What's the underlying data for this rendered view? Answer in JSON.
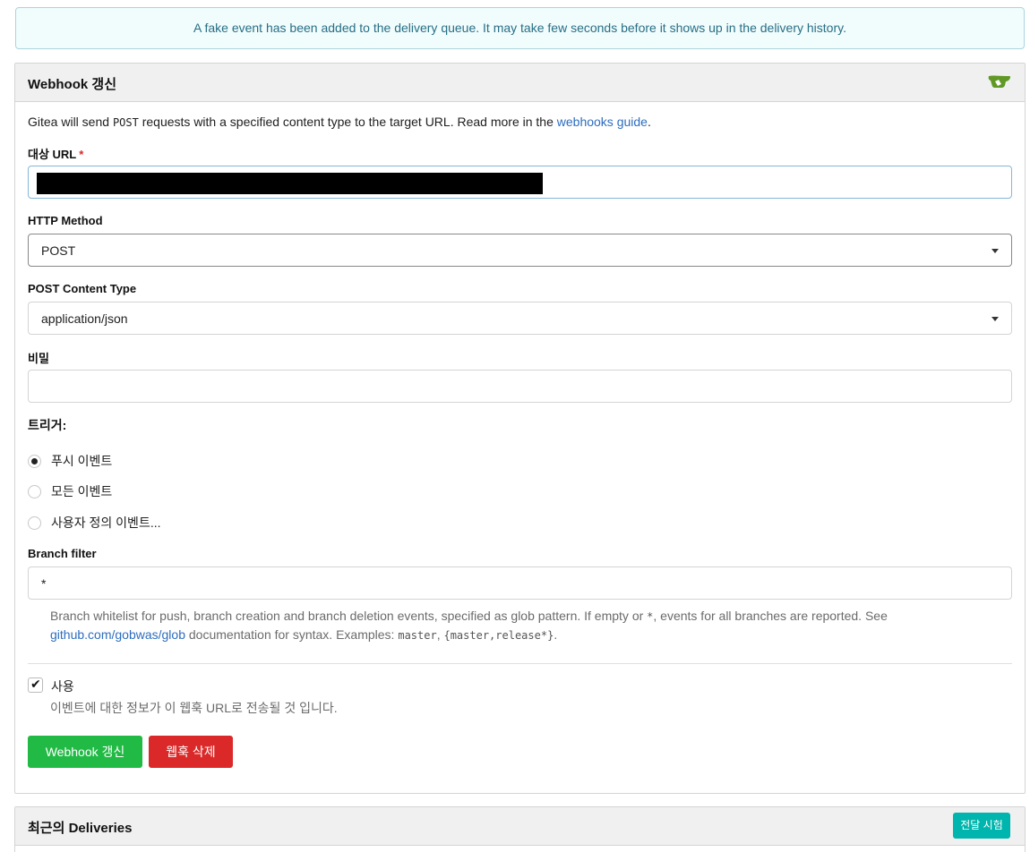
{
  "flash": {
    "message": "A fake event has been added to the delivery queue. It may take few seconds before it shows up in the delivery history."
  },
  "edit": {
    "title": "Webhook 갱신",
    "logo_icon": "gitea-logo-icon",
    "desc_before": "Gitea will send ",
    "desc_code": "POST",
    "desc_middle": " requests with a specified content type to the target URL. Read more in the ",
    "desc_link": "webhooks guide",
    "desc_after": ".",
    "target_url_label": "대상 URL",
    "required_mark": "*",
    "http_method_label": "HTTP Method",
    "http_method_value": "POST",
    "content_type_label": "POST Content Type",
    "content_type_value": "application/json",
    "secret_label": "비밀",
    "secret_value": "",
    "trigger_label": "트리거:",
    "triggers": [
      {
        "label": "푸시 이벤트",
        "checked": true
      },
      {
        "label": "모든 이벤트",
        "checked": false
      },
      {
        "label": "사용자 정의 이벤트...",
        "checked": false
      }
    ],
    "branch_filter_label": "Branch filter",
    "branch_filter_value": "*",
    "branch_help_1": "Branch whitelist for push, branch creation and branch deletion events, specified as glob pattern. If empty or ",
    "branch_help_star": "*",
    "branch_help_2": ", events for all branches are reported. See",
    "branch_help_link": "github.com/gobwas/glob",
    "branch_help_3": " documentation for syntax. Examples: ",
    "branch_help_ex1": "master",
    "branch_help_sep": ", ",
    "branch_help_ex2": "{master,release*}",
    "branch_help_end": ".",
    "active_label": "사용",
    "active_checked": true,
    "active_help": "이벤트에 대한 정보가 이 웹훅 URL로 전송될 것 입니다.",
    "update_button": "Webhook 갱신",
    "delete_button": "웹훅 삭제"
  },
  "deliveries": {
    "title": "최근의 Deliveries",
    "test_button": "전달 시험"
  },
  "colors": {
    "green": "#21ba45",
    "red": "#db2828",
    "teal": "#00b5ad",
    "link": "#2d6dbf"
  }
}
